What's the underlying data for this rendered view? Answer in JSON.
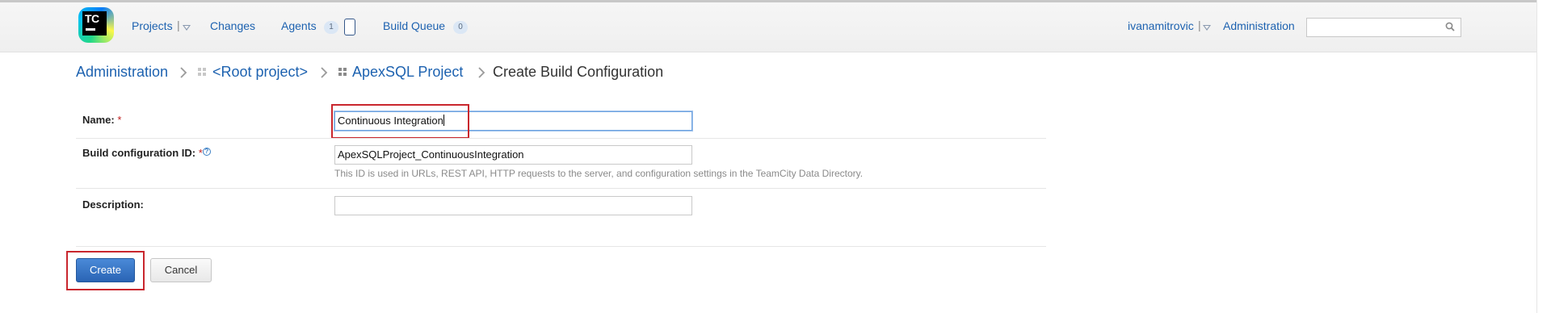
{
  "header": {
    "logo_text": "TC",
    "nav": {
      "projects": "Projects",
      "changes": "Changes",
      "agents": "Agents",
      "agents_count": "1",
      "build_queue": "Build Queue",
      "build_queue_count": "0"
    },
    "user": "ivanamitrovic",
    "administration": "Administration",
    "search": {
      "value": "",
      "placeholder": ""
    }
  },
  "breadcrumb": {
    "administration": "Administration",
    "root_project": "<Root project>",
    "project": "ApexSQL Project",
    "current": "Create Build Configuration"
  },
  "form": {
    "name_label": "Name:",
    "name_value": "Continuous Integration",
    "id_label": "Build configuration ID:",
    "id_value": "ApexSQLProject_ContinuousIntegration",
    "id_hint": "This ID is used in URLs, REST API, HTTP requests to the server, and configuration settings in the TeamCity Data Directory.",
    "description_label": "Description:",
    "description_value": "",
    "required_mark": "*",
    "help_glyph": "?"
  },
  "actions": {
    "create": "Create",
    "cancel": "Cancel"
  },
  "colors": {
    "link": "#1d62b0",
    "primary_button": "#2f6fc0",
    "highlight": "#c9272e"
  }
}
